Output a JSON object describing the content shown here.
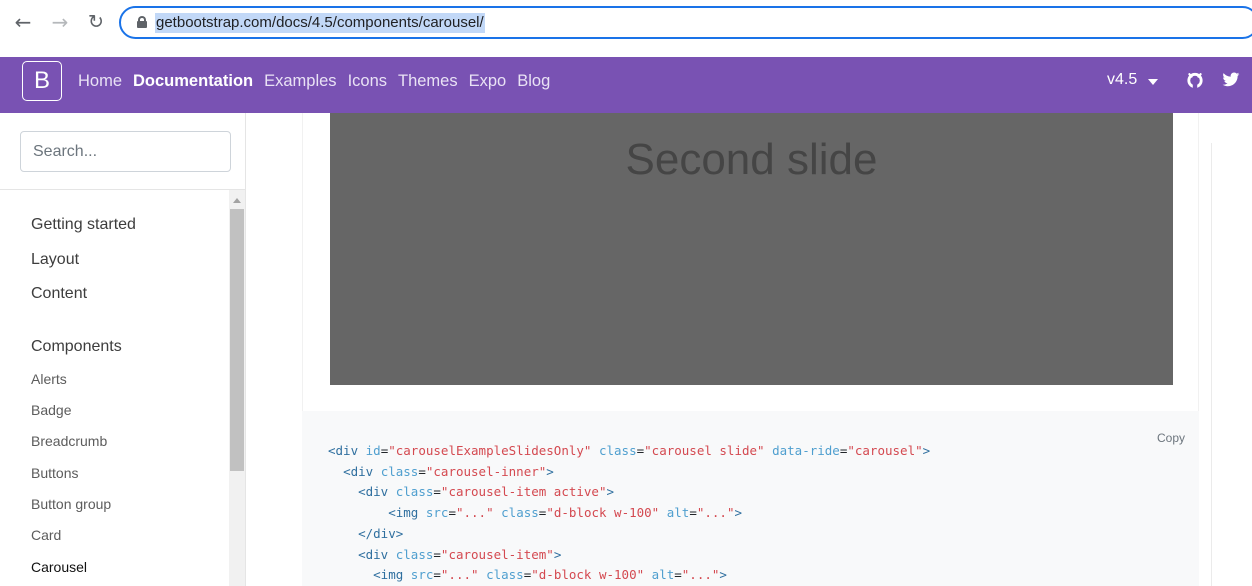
{
  "browser": {
    "url": "getbootstrap.com/docs/4.5/components/carousel/"
  },
  "navbar": {
    "brand": "B",
    "links": [
      {
        "label": "Home",
        "active": false
      },
      {
        "label": "Documentation",
        "active": true
      },
      {
        "label": "Examples",
        "active": false
      },
      {
        "label": "Icons",
        "active": false
      },
      {
        "label": "Themes",
        "active": false
      },
      {
        "label": "Expo",
        "active": false
      },
      {
        "label": "Blog",
        "active": false
      }
    ],
    "version": "v4.5",
    "accent_color": "#7952b3"
  },
  "sidebar": {
    "search_placeholder": "Search...",
    "top_items": [
      "Getting started",
      "Layout",
      "Content",
      "Components"
    ],
    "component_items": [
      "Alerts",
      "Badge",
      "Breadcrumb",
      "Buttons",
      "Button group",
      "Card",
      "Carousel"
    ],
    "current": "Carousel"
  },
  "main": {
    "slide_text": "Second slide",
    "copy_label": "Copy",
    "code_lines": [
      "<div id=\"carouselExampleSlidesOnly\" class=\"carousel slide\" data-ride=\"carousel\">",
      "  <div class=\"carousel-inner\">",
      "    <div class=\"carousel-item active\">",
      "        <img src=\"...\" class=\"d-block w-100\" alt=\"...\">",
      "    </div>",
      "    <div class=\"carousel-item\">",
      "      <img src=\"...\" class=\"d-block w-100\" alt=\"...\">"
    ]
  }
}
